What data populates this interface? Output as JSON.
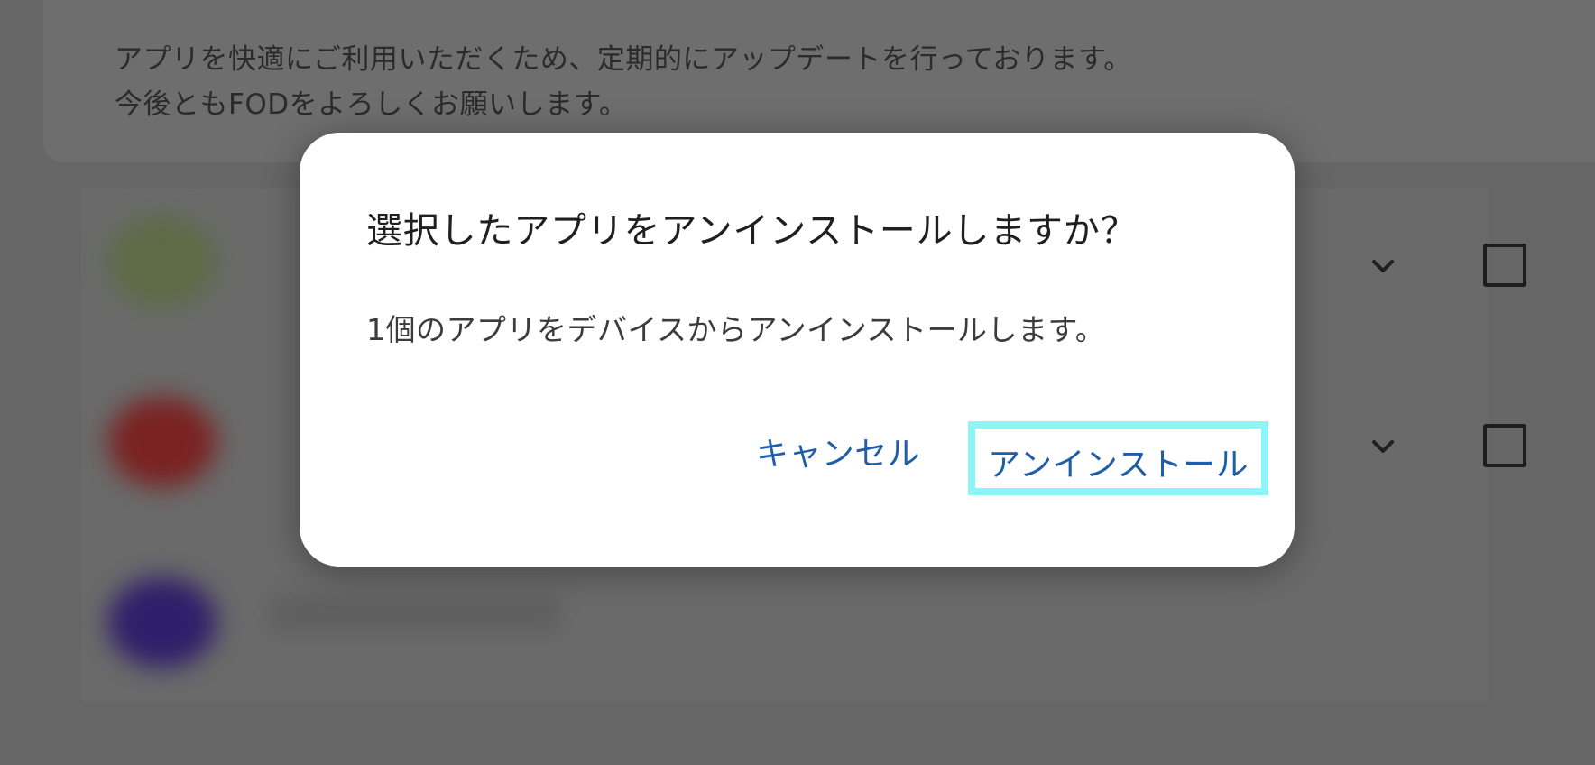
{
  "notice": {
    "line1": "アプリを快適にご利用いただくため、定期的にアップデートを行っております。",
    "line2": "今後ともFODをよろしくお願いします。"
  },
  "app_list": {
    "rows": [
      {
        "icon_color": "#5e6b45"
      },
      {
        "icon_color": "#7a2222"
      },
      {
        "icon_color": "#2e1f6a"
      }
    ],
    "chevron_icon": "chevron-down-icon",
    "checkbox_icon": "checkbox-unchecked-icon"
  },
  "dialog": {
    "title": "選択したアプリをアンインストールしますか？",
    "message": "1個のアプリをデバイスからアンインストールします。",
    "cancel_label": "キャンセル",
    "confirm_label": "アンインストール",
    "accent_color": "#1f5ea8",
    "highlight_color": "#8ef5f7"
  }
}
